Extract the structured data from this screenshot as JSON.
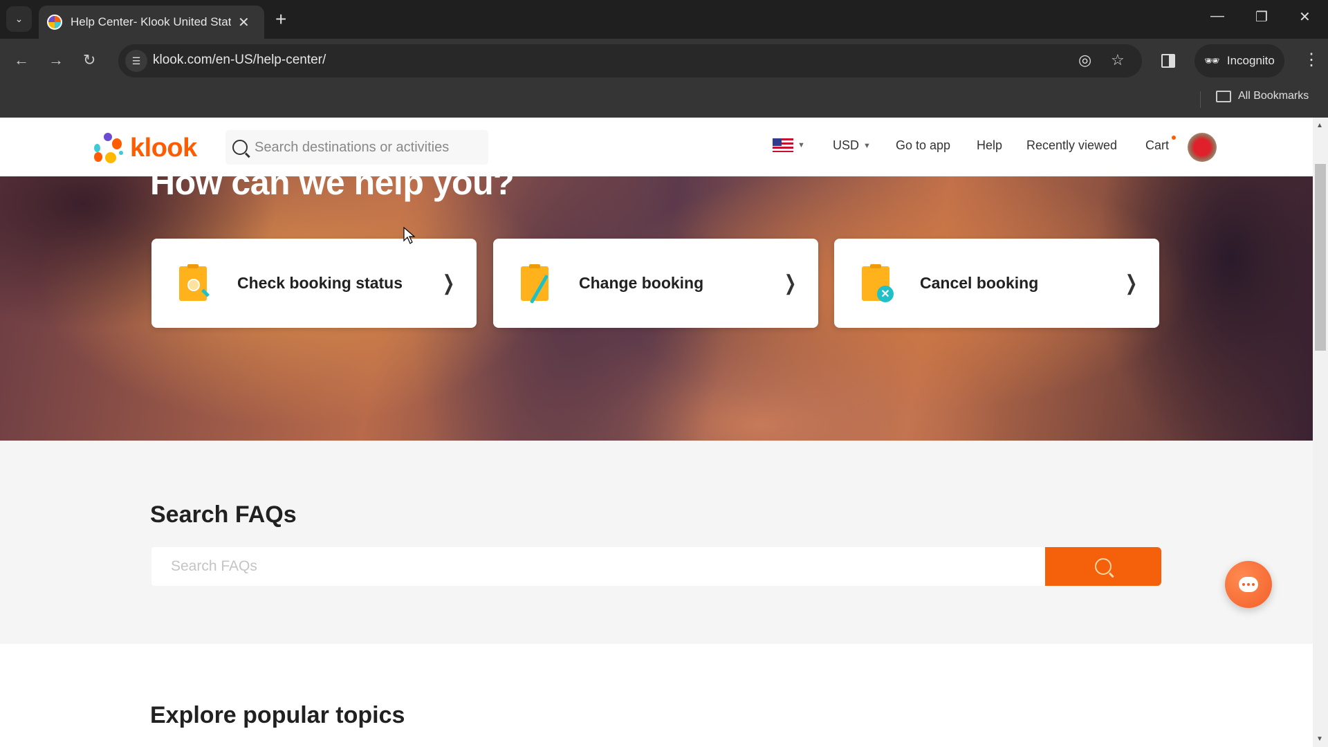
{
  "browser": {
    "tab_title": "Help Center- Klook United States",
    "url": "klook.com/en-US/help-center/",
    "incognito_label": "Incognito",
    "all_bookmarks_label": "All Bookmarks"
  },
  "header": {
    "logo_text": "klook",
    "search_placeholder": "Search destinations or activities",
    "locale_flag": "US",
    "currency": "USD",
    "nav": [
      "Go to app",
      "Help",
      "Recently viewed",
      "Cart"
    ]
  },
  "hero": {
    "title": "How can we help you?",
    "cards": [
      {
        "label": "Check booking status",
        "icon": "clipboard-search-icon"
      },
      {
        "label": "Change booking",
        "icon": "clipboard-edit-icon"
      },
      {
        "label": "Cancel booking",
        "icon": "clipboard-cancel-icon"
      }
    ]
  },
  "faq": {
    "title": "Search FAQs",
    "placeholder": "Search FAQs",
    "value": ""
  },
  "explore": {
    "title": "Explore popular topics"
  },
  "colors": {
    "brand": "#ff5b00",
    "search_button": "#f5600a",
    "icon_yellow": "#ffb21c",
    "icon_teal": "#1fc1c9"
  }
}
